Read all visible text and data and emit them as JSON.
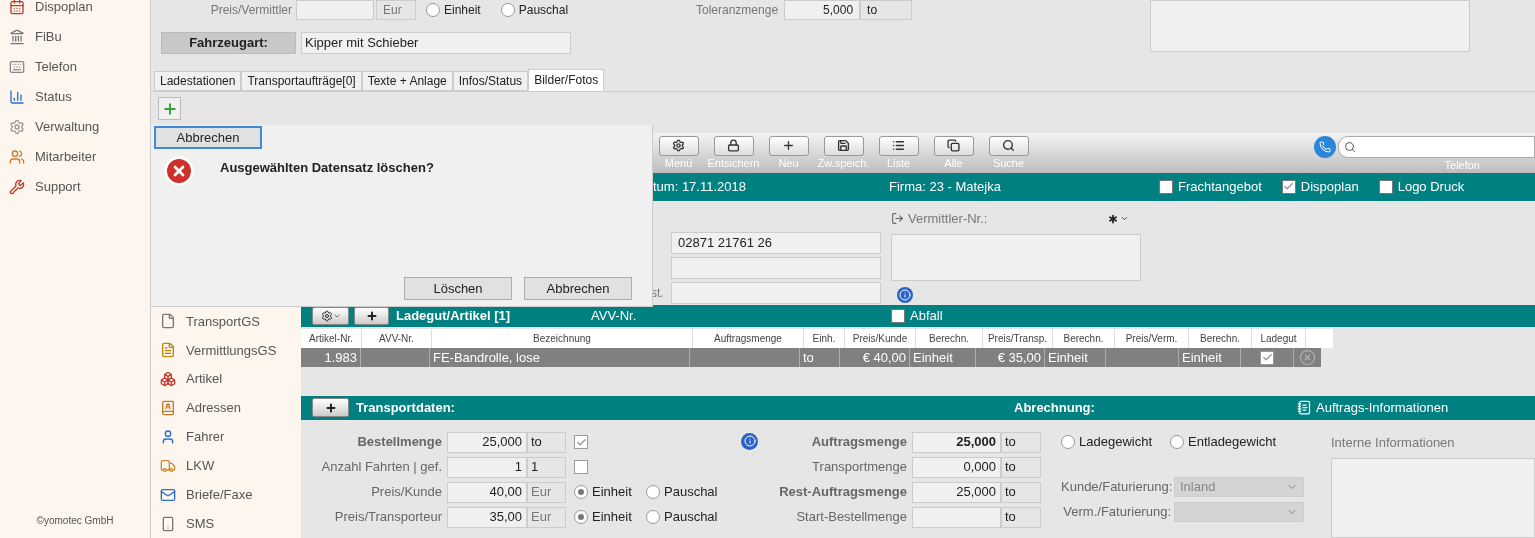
{
  "app_sidebar": {
    "items": [
      {
        "label": "Dispoplan"
      },
      {
        "label": "FiBu"
      },
      {
        "label": "Telefon"
      },
      {
        "label": "Status"
      },
      {
        "label": "Verwaltung"
      },
      {
        "label": "Mitarbeiter"
      },
      {
        "label": "Support"
      }
    ],
    "footer": "©yomotec GmbH"
  },
  "top_form": {
    "preis_vermittler": {
      "label": "Preis/Vermittler",
      "unit": "Eur",
      "options": [
        {
          "label": "Einheit",
          "selected": false
        },
        {
          "label": "Pauschal",
          "selected": false
        }
      ]
    },
    "toleranz": {
      "label": "Toleranzmenge",
      "value": "5,000",
      "unit": "to"
    },
    "fahrzeugart": {
      "label": "Fahrzeugart:",
      "value": "Kipper mit Schieber"
    }
  },
  "tabs": [
    {
      "label": "Ladestationen",
      "selected": false
    },
    {
      "label": "Transportaufträge[0]",
      "selected": false
    },
    {
      "label": "Texte + Anlage",
      "selected": false
    },
    {
      "label": "Infos/Status",
      "selected": false
    },
    {
      "label": "Bilder/Fotos",
      "selected": true
    }
  ],
  "dialog": {
    "top_button": "Abbrechen",
    "message": "Ausgewählten Datensatz löschen?",
    "buttons": [
      "Löschen",
      "Abbrechen"
    ]
  },
  "inner_window": {
    "sidebar": [
      {
        "label": "TransportGS"
      },
      {
        "label": "VermittlungsGS"
      },
      {
        "label": "Artikel"
      },
      {
        "label": "Adressen"
      },
      {
        "label": "Fahrer"
      },
      {
        "label": "LKW"
      },
      {
        "label": "Briefe/Faxe"
      },
      {
        "label": "SMS"
      }
    ],
    "toolbar": [
      {
        "kind": "gear",
        "label": "Menü"
      },
      {
        "kind": "lock",
        "label": "Entsichern"
      },
      {
        "kind": "plus",
        "label": "Neu"
      },
      {
        "kind": "save",
        "label": "Zw.speich."
      },
      {
        "kind": "list",
        "label": "Liste"
      },
      {
        "kind": "all",
        "label": "Alle"
      },
      {
        "kind": "search",
        "label": "Suche"
      }
    ],
    "phone_search": {
      "label": "Telefon"
    },
    "header_bar": {
      "date": "tum: 17.11.2018",
      "firma": "Firma: 23 - Matejka",
      "checks": [
        {
          "label": "Frachtangebot",
          "checked": false
        },
        {
          "label": "Dispoplan",
          "checked": true
        },
        {
          "label": "Logo Druck",
          "checked": false
        }
      ]
    },
    "contact": {
      "phone": "02871 21761 26",
      "cut_label": "st.",
      "vermittler_label": "Vermittler-Nr.:"
    },
    "ladegut": {
      "title": "Ladegut/Artikel [1]",
      "avv_label": "AVV-Nr.",
      "abfall": {
        "label": "Abfall",
        "checked": false
      },
      "columns": [
        {
          "label": "Artikel-Nr."
        },
        {
          "label": "AVV-Nr."
        },
        {
          "label": "Bezeichnung"
        },
        {
          "label": "Auftragsmenge"
        },
        {
          "label": "Einh."
        },
        {
          "label": "Preis/Kunde"
        },
        {
          "label": "Berechn."
        },
        {
          "label": "Preis/Transp."
        },
        {
          "label": "Berechn."
        },
        {
          "label": "Preis/Verm."
        },
        {
          "label": "Berechn."
        },
        {
          "label": "Ladegut"
        }
      ],
      "rows": [
        {
          "selected": true,
          "cells": [
            "1.983",
            "",
            "FE-Bandrolle, lose",
            "",
            "to",
            "€ 40,00",
            "Einheit",
            "€ 35,00",
            "Einheit",
            "",
            "Einheit"
          ],
          "ladegut": true
        }
      ]
    },
    "transport": {
      "title": "Transportdaten:",
      "abrechnung": "Abrechnung:",
      "info_link": "Auftrags-Informationen",
      "left_rows": [
        {
          "kind": "check",
          "label": "Bestellmenge",
          "bold": true,
          "value": "25,000",
          "unit": "to",
          "checked": true
        },
        {
          "kind": "check",
          "label": "Anzahl Fahrten | gef.",
          "bold": false,
          "value": "1",
          "unit": "1",
          "checked": false
        },
        {
          "kind": "radio",
          "label": "Preis/Kunde",
          "bold": false,
          "value": "40,00",
          "unit": "Eur",
          "options": [
            {
              "label": "Einheit",
              "selected": true
            },
            {
              "label": "Pauschal",
              "selected": false
            }
          ]
        },
        {
          "kind": "radio",
          "label": "Preis/Transporteur",
          "bold": false,
          "value": "35,00",
          "unit": "Eur",
          "options": [
            {
              "label": "Einheit",
              "selected": true
            },
            {
              "label": "Pauschal",
              "selected": false
            }
          ]
        }
      ],
      "mid_rows": [
        {
          "label": "Auftragsmenge",
          "bold": true,
          "value": "25,000",
          "unit": "to"
        },
        {
          "label": "Transportmenge",
          "bold": false,
          "value": "0,000",
          "unit": "to"
        },
        {
          "label": "Rest-Auftragsmenge",
          "bold": true,
          "value": "25,000",
          "unit": "to"
        },
        {
          "label": "Start-Bestellmenge",
          "bold": false,
          "unit": "to"
        }
      ],
      "weights": [
        {
          "label": "Ladegewicht",
          "selected": false
        },
        {
          "label": "Entladegewicht",
          "selected": false
        }
      ],
      "billing": [
        {
          "label": "Kunde/Faturierung:",
          "value": "Inland"
        },
        {
          "label": "Verm./Faturierung:"
        }
      ],
      "internal_label": "Interne Informationen"
    }
  }
}
